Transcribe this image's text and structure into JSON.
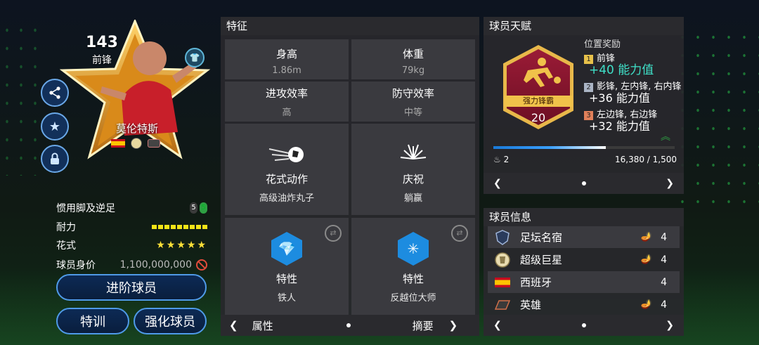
{
  "player_card": {
    "rating": "143",
    "position": "前锋",
    "name": "莫伦特斯"
  },
  "player_stats": {
    "weak_foot_label": "惯用脚及逆足",
    "weak_foot_values": [
      "5",
      "5"
    ],
    "stamina_label": "耐力",
    "skills_label": "花式",
    "skills_stars": "★★★★★",
    "value_label": "球员身价",
    "value": "1,100,000,000"
  },
  "buttons": {
    "advance": "进阶球员",
    "train": "特训",
    "enhance": "强化球员"
  },
  "features_panel": {
    "title": "特征",
    "height_label": "身高",
    "height_value": "1.86m",
    "weight_label": "体重",
    "weight_value": "79kg",
    "att_wr_label": "进攻效率",
    "att_wr_value": "高",
    "def_wr_label": "防守效率",
    "def_wr_value": "中等",
    "skill_move_label": "花式动作",
    "skill_move_value": "高级油炸丸子",
    "celebration_label": "庆祝",
    "celebration_value": "躺赢",
    "trait1_label": "特性",
    "trait1_value": "铁人",
    "trait2_label": "特性",
    "trait2_value": "反越位大师",
    "footer_left": "属性",
    "footer_right": "摘要"
  },
  "talent_panel": {
    "title": "球员天赋",
    "badge_name": "强力锋霸",
    "badge_level": "20",
    "bonus_title": "位置奖励",
    "rank1_num": "1",
    "rank1_pos": "前锋",
    "rank1_val": "+40 能力值",
    "rank2_num": "2",
    "rank2_pos": "影锋, 左内锋, 右内锋",
    "rank2_val": "+36 能力值",
    "rank3_num": "3",
    "rank3_pos": "左边锋, 右边锋",
    "rank3_val": "+32 能力值",
    "count": "2",
    "progress_text": "16,380 / 1,500",
    "progress_fraction": 0.62
  },
  "info_panel": {
    "title": "球员信息",
    "rows": [
      {
        "label": "足坛名宿",
        "count": "4"
      },
      {
        "label": "超级巨星",
        "count": "4"
      },
      {
        "label": "西班牙",
        "count": "4"
      },
      {
        "label": "英雄",
        "count": "4"
      }
    ]
  },
  "colors": {
    "accent_blue": "#4f9ae8",
    "positive_green": "#3fe0c8",
    "star_yellow": "#ffe138"
  }
}
